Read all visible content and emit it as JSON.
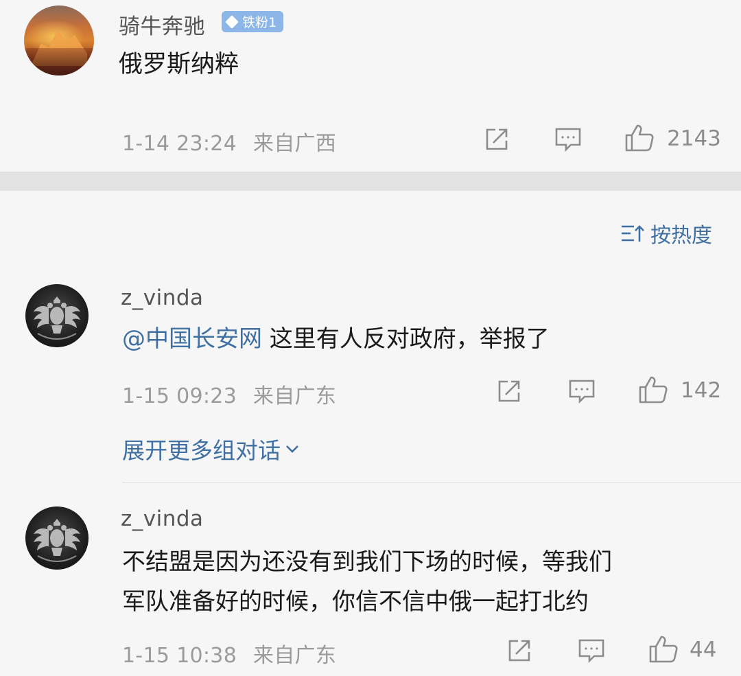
{
  "post": {
    "username": "骑牛奔驰",
    "badge": "铁粉1",
    "text": "俄罗斯纳粹",
    "timestamp": "1-14 23:24",
    "location": "来自广西",
    "likes": "2143"
  },
  "comments_header": {
    "sort_label": "按热度",
    "sort_icon": "sort-icon"
  },
  "comments": [
    {
      "username": "z_vinda",
      "mention": "@中国长安网",
      "text": " 这里有人反对政府，举报了",
      "timestamp": "1-15 09:23",
      "location": "来自广东",
      "likes": "142",
      "expand_label": "展开更多组对话"
    },
    {
      "username": "z_vinda",
      "text_line1": "不结盟是因为还没有到我们下场的时候，等我们",
      "text_line2": "军队准备好的时候，你信不信中俄一起打北约",
      "timestamp": "1-15 10:38",
      "location": "来自广东",
      "likes": "44"
    }
  ],
  "icons": {
    "share": "share-icon",
    "comment": "comment-icon",
    "like": "thumbs-up-icon",
    "chevron": "chevron-down-icon"
  },
  "colors": {
    "link": "#3f6fa3",
    "meta": "#9b9b9b",
    "badge": "#8db6e8",
    "background": "#f6f6f6",
    "separator": "#e3e3e3"
  }
}
